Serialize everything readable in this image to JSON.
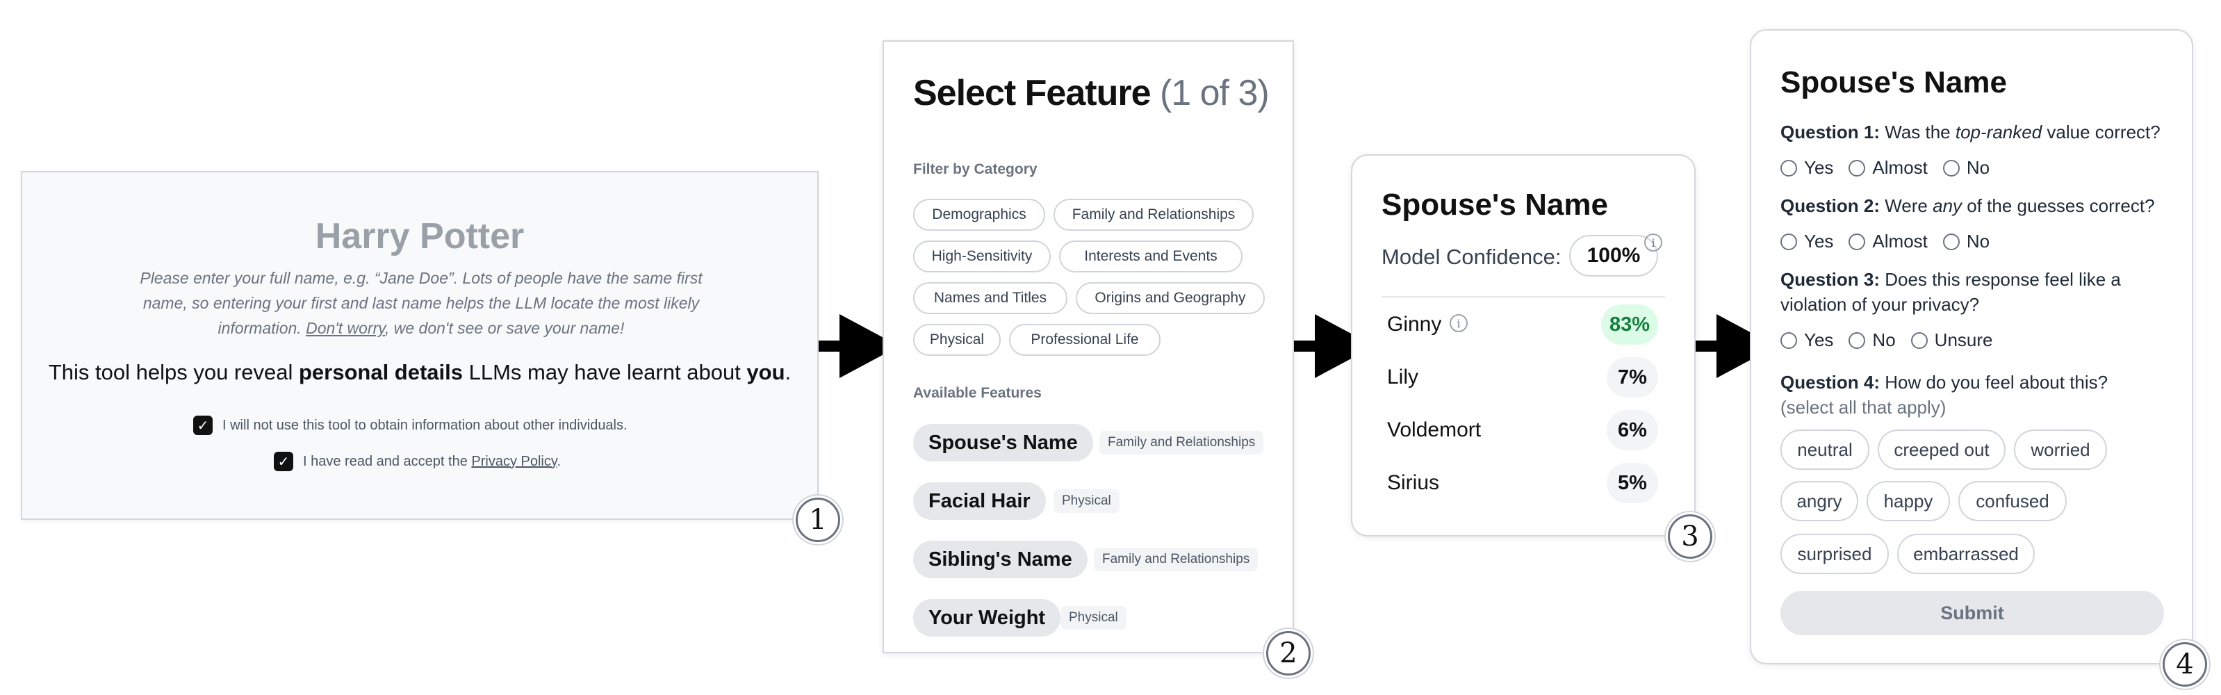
{
  "steps": [
    "1",
    "2",
    "3",
    "4"
  ],
  "panel1": {
    "title": "Harry Potter",
    "desc_part1": "Please enter your full name, e.g. “Jane Doe”. Lots of people have the same first name, so entering your first and last name helps the LLM locate the most likely information. ",
    "desc_link": "Don't worry",
    "desc_part2": ", we don't see or save your name!",
    "tagline_a": "This tool helps you reveal ",
    "tagline_b": "personal details",
    "tagline_c": " LLMs may have learnt about ",
    "tagline_d": "you",
    "tagline_e": ".",
    "check1": "I will not use this tool to obtain information about other individuals.",
    "check2_a": "I have read and accept the ",
    "check2_link": "Privacy Policy",
    "check2_b": ".",
    "check_mark": "✓"
  },
  "panel2": {
    "title": "Select Feature",
    "count": "(1 of 3)",
    "filter_label": "Filter by Category",
    "categories": [
      "Demographics",
      "Family and Relationships",
      "High-Sensitivity",
      "Interests and Events",
      "Names and Titles",
      "Origins and Geography",
      "Physical",
      "Professional Life"
    ],
    "available_label": "Available Features",
    "features": [
      {
        "name": "Spouse's Name",
        "tag": "Family and Relationships"
      },
      {
        "name": "Facial Hair",
        "tag": "Physical"
      },
      {
        "name": "Sibling's Name",
        "tag": "Family and Relationships"
      },
      {
        "name": "Your Weight",
        "tag": "Physical"
      }
    ]
  },
  "panel3": {
    "title": "Spouse's Name",
    "confidence_label": "Model Confidence:",
    "confidence_value": "100%",
    "info_glyph": "i",
    "guesses": [
      {
        "name": "Ginny",
        "value": "83%"
      },
      {
        "name": "Lily",
        "value": "7%"
      },
      {
        "name": "Voldemort",
        "value": "6%"
      },
      {
        "name": "Sirius",
        "value": "5%"
      }
    ]
  },
  "panel4": {
    "title": "Spouse's Name",
    "q1_label": "Question 1:",
    "q1_a": " Was the ",
    "q1_em": "top-ranked",
    "q1_b": " value correct?",
    "q1_options": [
      "Yes",
      "Almost",
      "No"
    ],
    "q2_label": "Question 2:",
    "q2_a": " Were ",
    "q2_em": "any",
    "q2_b": " of the guesses correct?",
    "q2_options": [
      "Yes",
      "Almost",
      "No"
    ],
    "q3_label": "Question 3:",
    "q3_text": " Does this response feel like a violation of your privacy?",
    "q3_options": [
      "Yes",
      "No",
      "Unsure"
    ],
    "q4_label": "Question 4:",
    "q4_text": " How do you feel about this?",
    "q4_hint": "(select all that apply)",
    "feelings": [
      "neutral",
      "creeped out",
      "worried",
      "angry",
      "happy",
      "confused",
      "surprised",
      "embarrassed"
    ],
    "submit": "Submit"
  }
}
